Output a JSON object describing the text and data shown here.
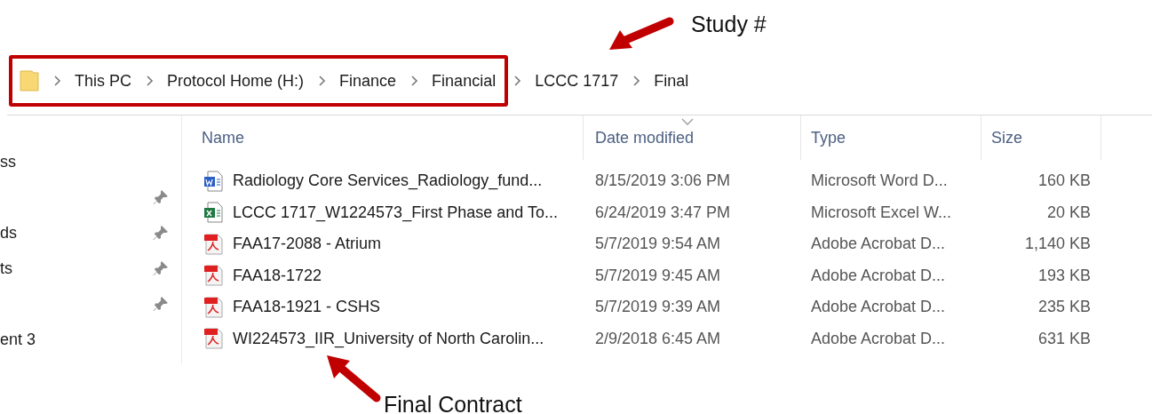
{
  "annotations": [
    {
      "text": "Study #"
    },
    {
      "text": "Final Contract"
    }
  ],
  "breadcrumb": {
    "groups": [
      {
        "kind": "highlighted",
        "items": [
          "This PC",
          "Protocol Home (H:)",
          "Finance",
          "Financial"
        ]
      },
      {
        "kind": "plain",
        "items": [
          "LCCC 1717",
          "Final"
        ]
      }
    ]
  },
  "sidebar": {
    "items": [
      {
        "label": "ss",
        "pinned": false
      },
      {
        "pinned": true
      },
      {
        "label": "ds",
        "pinned": true
      },
      {
        "label": "ts",
        "pinned": true
      },
      {
        "pinned": true
      },
      {
        "label": "ent 3",
        "pinned": false
      }
    ]
  },
  "table": {
    "columns": [
      {
        "label": "Name",
        "sorted": false
      },
      {
        "label": "Date modified",
        "sorted": true
      },
      {
        "label": "Type",
        "sorted": false
      },
      {
        "label": "Size",
        "sorted": false
      }
    ],
    "rows": [
      {
        "kind": "word",
        "name": "Radiology Core Services_Radiology_fund...",
        "date": "8/15/2019 3:06 PM",
        "type": "Microsoft Word D...",
        "size": "160 KB"
      },
      {
        "kind": "excel",
        "name": "LCCC 1717_W1224573_First Phase and To...",
        "date": "6/24/2019 3:47 PM",
        "type": "Microsoft Excel W...",
        "size": "20 KB"
      },
      {
        "kind": "pdf",
        "name": "FAA17-2088 - Atrium",
        "date": "5/7/2019 9:54 AM",
        "type": "Adobe Acrobat D...",
        "size": "1,140 KB"
      },
      {
        "kind": "pdf",
        "name": "FAA18-1722",
        "date": "5/7/2019 9:45 AM",
        "type": "Adobe Acrobat D...",
        "size": "193 KB"
      },
      {
        "kind": "pdf",
        "name": "FAA18-1921 - CSHS",
        "date": "5/7/2019 9:39 AM",
        "type": "Adobe Acrobat D...",
        "size": "235 KB"
      },
      {
        "kind": "pdf",
        "name": "WI224573_IIR_University of North Carolin...",
        "date": "2/9/2018 6:45 AM",
        "type": "Adobe Acrobat D...",
        "size": "631 KB"
      }
    ]
  }
}
